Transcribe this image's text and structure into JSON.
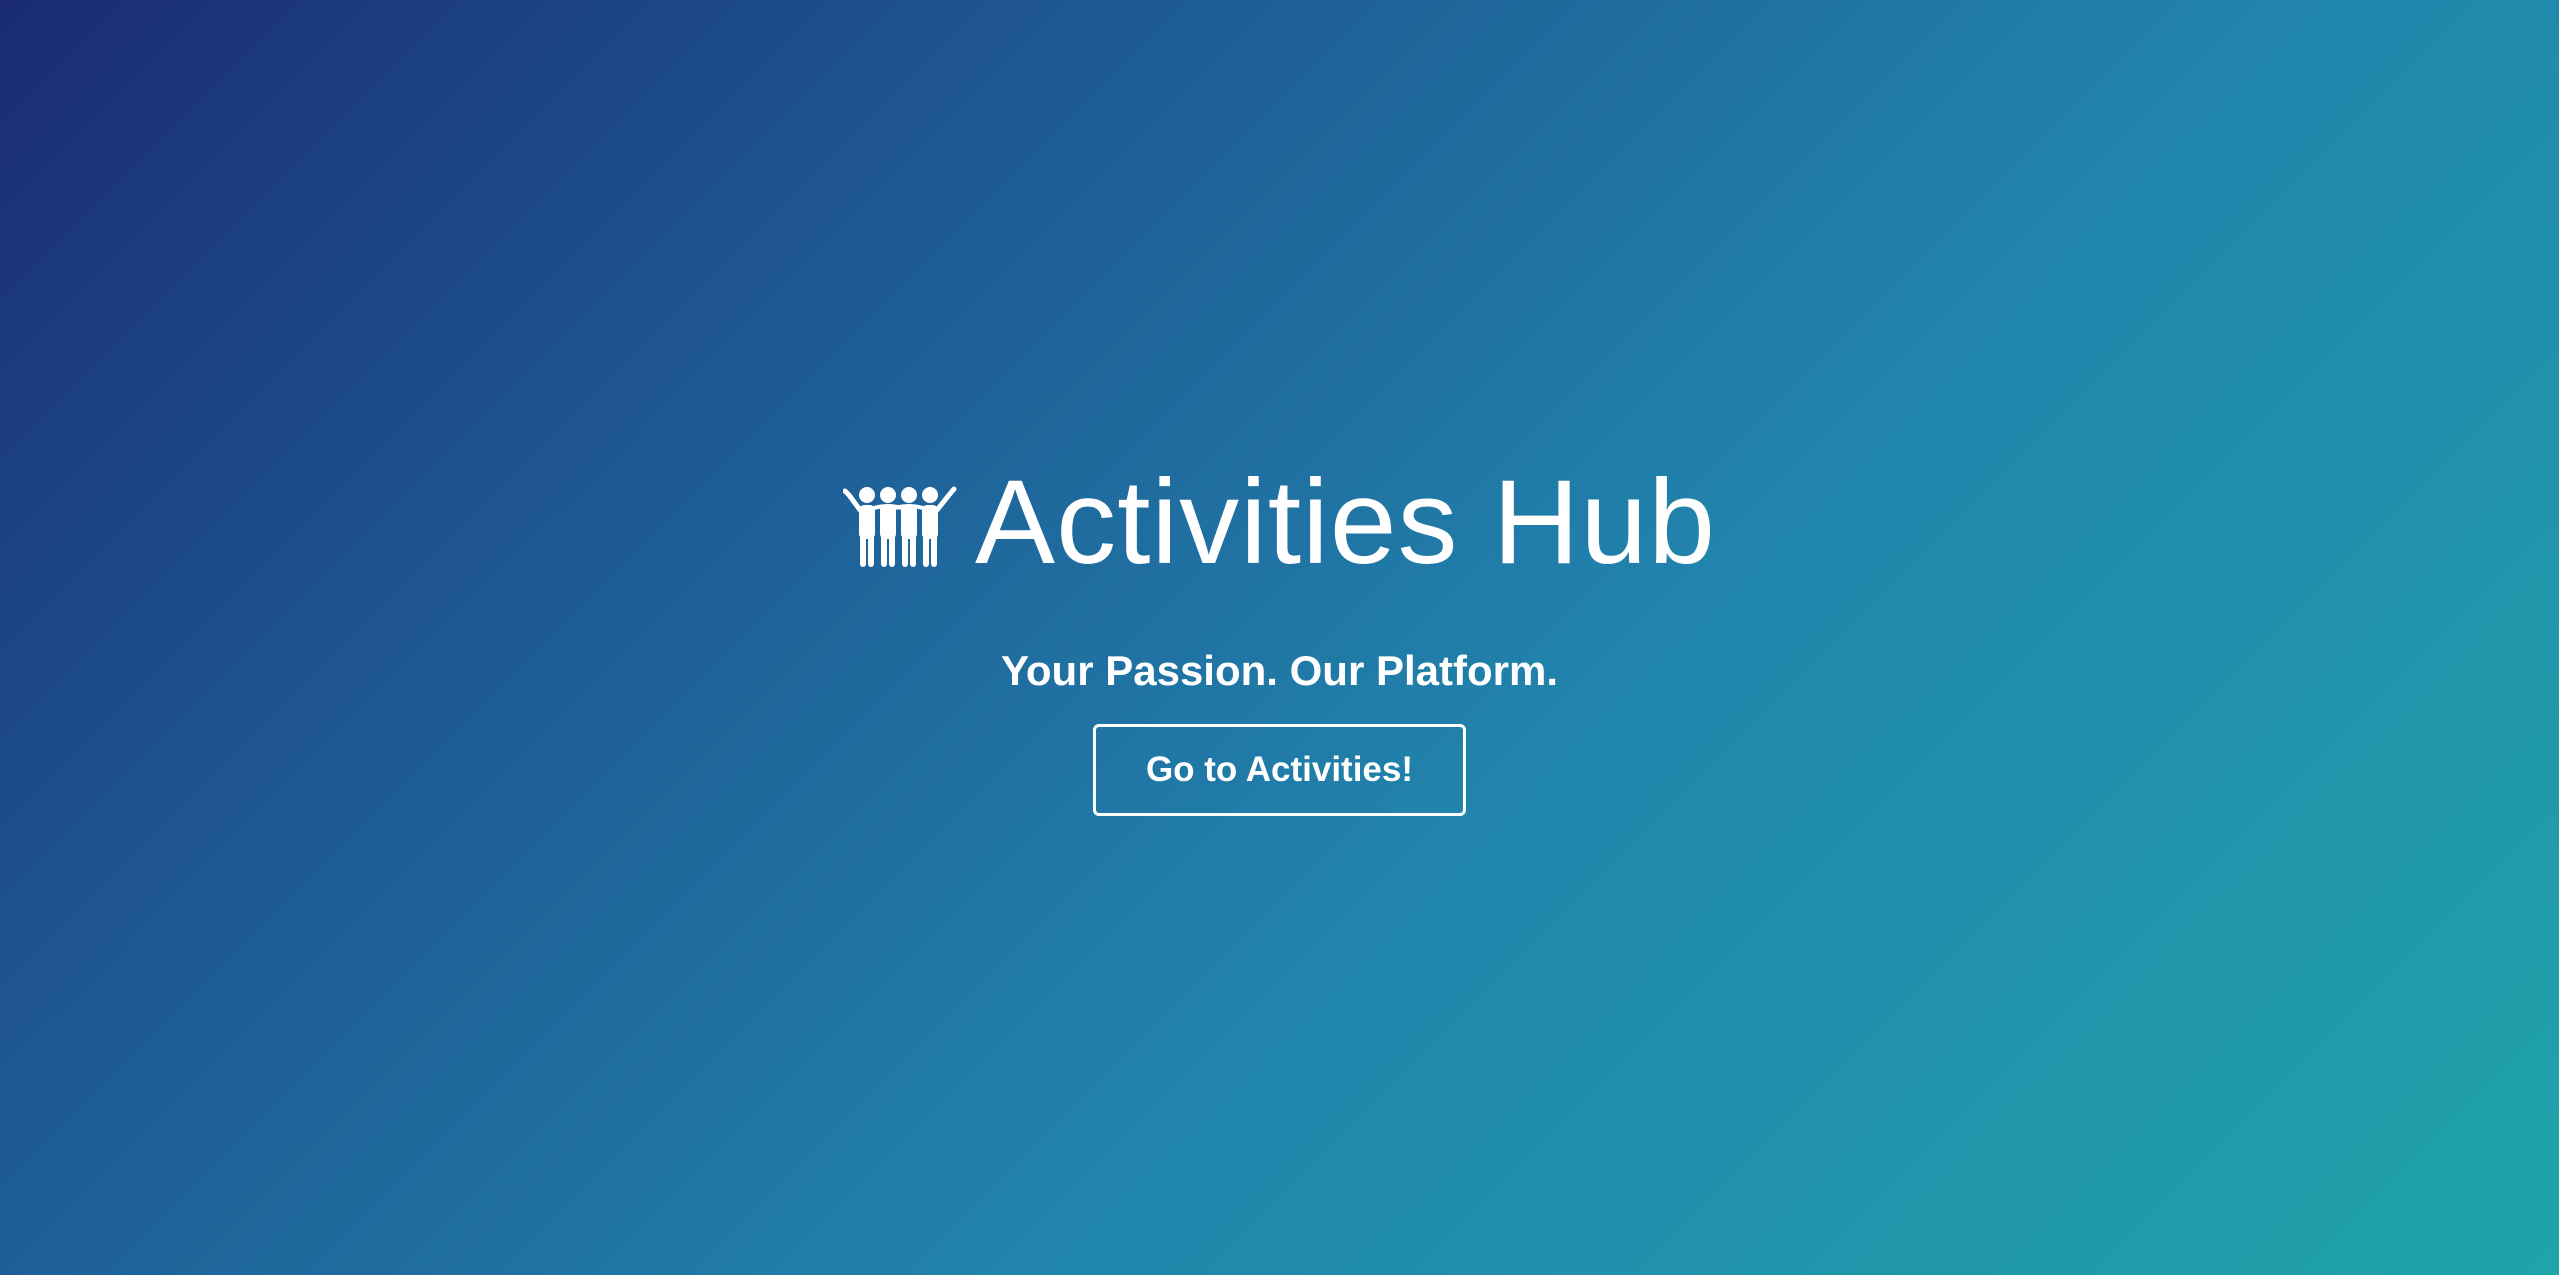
{
  "hero": {
    "logo_icon": "people-group-icon",
    "title": "Activities Hub",
    "tagline": "Your Passion. Our Platform.",
    "cta_label": "Go to Activities!"
  },
  "colors": {
    "gradient_start": "#1a2a75",
    "gradient_mid": "#2185ad",
    "gradient_end": "#1fa4a9",
    "text": "#ffffff"
  }
}
